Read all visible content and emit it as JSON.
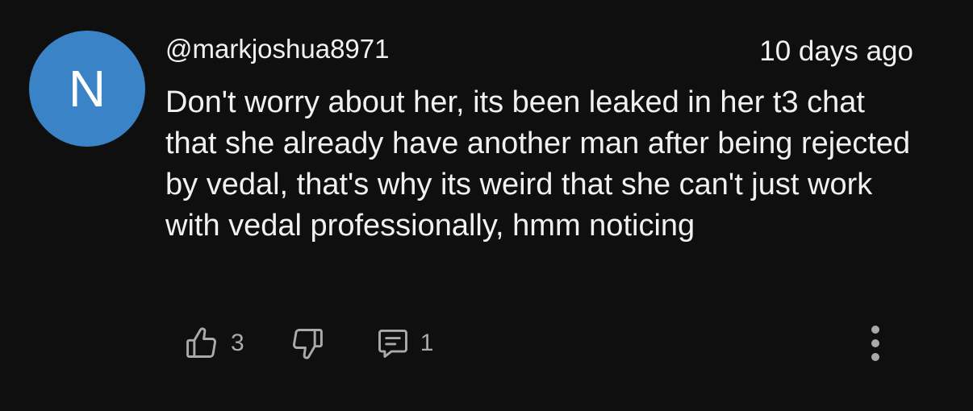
{
  "comment": {
    "avatar_letter": "N",
    "avatar_color": "#3a83c6",
    "author": "@markjoshua8971",
    "timestamp": "10 days ago",
    "text": "Don't worry about her, its been leaked in her t3 chat that she already have another man after being rejected by vedal, that's why its weird that she can't just work with vedal professionally, hmm noticing",
    "like_count": "3",
    "reply_count": "1"
  },
  "icons": {
    "like": "thumbs-up-icon",
    "dislike": "thumbs-down-icon",
    "reply": "comment-icon",
    "more": "more-vertical-icon"
  },
  "theme": {
    "background": "#0f0f0f",
    "text": "#f1f1f1",
    "muted": "#aaaaaa"
  }
}
